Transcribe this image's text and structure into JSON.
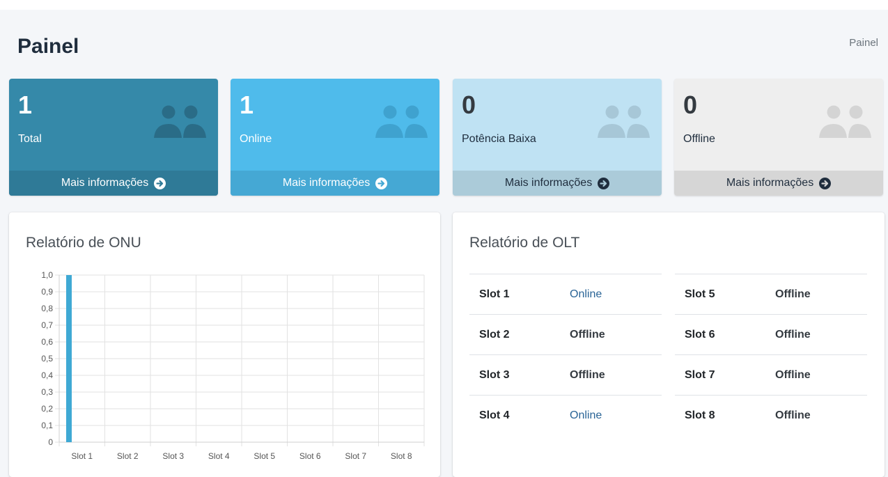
{
  "header": {
    "title": "Painel",
    "breadcrumb": "Painel"
  },
  "stats": [
    {
      "count": "1",
      "label": "Total",
      "more": "Mais informações"
    },
    {
      "count": "1",
      "label": "Online",
      "more": "Mais informações"
    },
    {
      "count": "0",
      "label": "Potência Baixa",
      "more": "Mais informações"
    },
    {
      "count": "0",
      "label": "Offline",
      "more": "Mais informações"
    }
  ],
  "onu_report": {
    "title": "Relatório de ONU"
  },
  "olt_report": {
    "title": "Relatório de OLT",
    "slots": [
      {
        "name": "Slot 1",
        "status": "Online"
      },
      {
        "name": "Slot 2",
        "status": "Offline"
      },
      {
        "name": "Slot 3",
        "status": "Offline"
      },
      {
        "name": "Slot 4",
        "status": "Online"
      },
      {
        "name": "Slot 5",
        "status": "Offline"
      },
      {
        "name": "Slot 6",
        "status": "Offline"
      },
      {
        "name": "Slot 7",
        "status": "Offline"
      },
      {
        "name": "Slot 8",
        "status": "Offline"
      }
    ]
  },
  "icons": {
    "stat_icon": "users-icon",
    "more_icon": "arrow-circle-right-icon"
  },
  "colors": {
    "total": "#3589a9",
    "online": "#4fbbeb",
    "low_power": "#bfe2f3",
    "offline": "#eeeeee",
    "bar": "#3fa9d4"
  },
  "chart_data": {
    "type": "bar",
    "categories": [
      "Slot 1",
      "Slot 2",
      "Slot 3",
      "Slot 4",
      "Slot 5",
      "Slot 6",
      "Slot 7",
      "Slot 8"
    ],
    "values": [
      1,
      0,
      0,
      0,
      0,
      0,
      0,
      0
    ],
    "ylim": [
      0,
      1
    ],
    "yticks": [
      "0",
      "0,1",
      "0,2",
      "0,3",
      "0,4",
      "0,5",
      "0,6",
      "0,7",
      "0,8",
      "0,9",
      "1,0"
    ],
    "grid": true,
    "title": "",
    "xlabel": "",
    "ylabel": ""
  }
}
